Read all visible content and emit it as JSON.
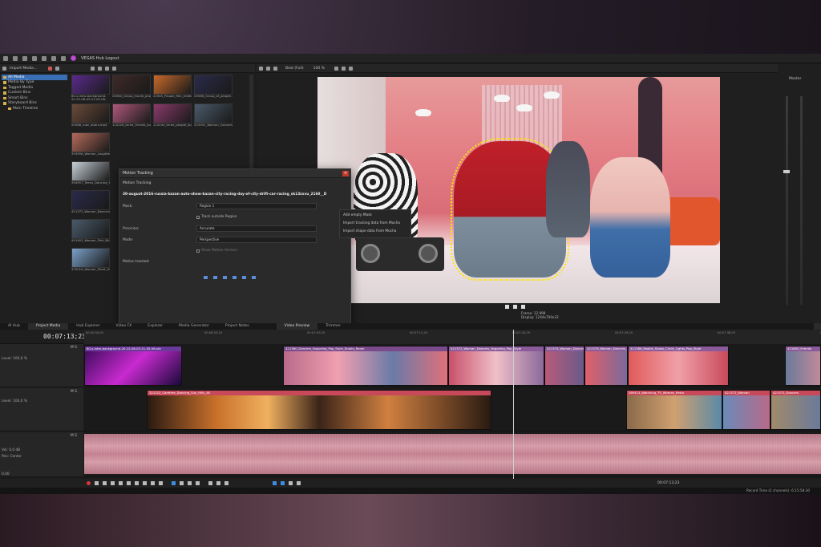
{
  "app": {
    "hub_label": "VEGAS Hub Logout"
  },
  "explorer": {
    "import_label": "Import Media...",
    "tree": [
      {
        "label": "All Media",
        "selected": true
      },
      {
        "label": "Media By Type",
        "selected": false
      },
      {
        "label": "Tagged Media",
        "selected": false
      },
      {
        "label": "Custom Bins",
        "selected": false
      },
      {
        "label": "Smart Bins",
        "selected": false
      },
      {
        "label": "Storyboard Bins",
        "selected": false
      },
      {
        "label": "Main Timeline",
        "selected": false
      }
    ],
    "thumbs": [
      [
        "80-s-intro-background-20-22-08-03-21-05-06-utc...",
        "20564_Group_movie_projector.mp4",
        "20565_People_film_rediector.mp4",
        "20566_Group_of_people..."
      ],
      [
        "20568_man_stairs.mp4",
        "110226_three_friends_looking_at_a_laptop_scr...",
        "110240_three_people_looking_straight_in_the_...",
        "253951_Women_Conversation_Bar_Alcohol_4K..."
      ],
      [
        "353958_Woman_Laughter_Bonding_Conversati...",
        "",
        "",
        ""
      ],
      [
        "394957_Teens_Dancing_Young_Bridge_4K.mp4",
        "",
        "",
        ""
      ],
      [
        "421372_Woman_Dancers_Vogueing_Pop_Style_4...",
        "",
        "",
        ""
      ],
      [
        "441902_Woman_Pink_Bride_Yellow_Jacket_Sm...",
        "",
        "",
        ""
      ],
      [
        "470016_Woman_Short_Hair_Earring_Blue_Dress...",
        "",
        "",
        ""
      ]
    ]
  },
  "preview": {
    "quality": "Best (Full)",
    "zoom": "100 %",
    "project": "Project:  1920x1080x32, 29,970p",
    "preview_res": "Preview:  1920x1080x32, 29,970p",
    "frame": "Frame:    12.999",
    "display": "Display:  1244x700x32"
  },
  "motion_tracking": {
    "title": "Motion Tracking",
    "section": "Motion Tracking",
    "file": "30-august-2016-russia-kazan-auto-show-kazan-city-racing-day-of-city-drift-car-racing_sk13zxvu_2160__D",
    "mask_label": "Mask:",
    "mask_value": "Region 1",
    "track_outside": "Track outside Region",
    "precision_label": "Precision:",
    "precision_value": "Accurate",
    "mode_label": "Mode:",
    "mode_value": "Perspective",
    "show_motion": "Show Motion Vectors",
    "tracked_label": "Motion tracked:",
    "menu": [
      "Add empty Mask",
      "Import tracking data from Mocha",
      "Import shape data from Mocha"
    ]
  },
  "master": {
    "label": "Master"
  },
  "tabs": [
    {
      "label": "AI Hub",
      "active": false
    },
    {
      "label": "Project Media",
      "active": true
    },
    {
      "label": "Hub Explorer",
      "active": false
    },
    {
      "label": "Video FX",
      "active": false
    },
    {
      "label": "Explorer",
      "active": false
    },
    {
      "label": "Media Generator",
      "active": false
    },
    {
      "label": "Project Notes",
      "active": false
    },
    {
      "label": "Video Preview",
      "active": true
    },
    {
      "label": "Trimmer",
      "active": false
    },
    {
      "label": "Master Bus",
      "active": true
    }
  ],
  "timeline": {
    "timecode": "00:07:13;23",
    "ruler": [
      "00:00:00;00",
      "00:06:53;29",
      "00:07:02;29",
      "00:07:11;29",
      "00:07:20;29",
      "00:07:29;29",
      "00:07:38;29",
      "00:07:47;29"
    ],
    "track1_level": "Level: 100,0 %",
    "track2_level": "Level: 100,0 %",
    "audio_vol": "Vol:      0,0 dB",
    "audio_pan": "Pan:      Center",
    "rate": "0,00",
    "clips_v1": [
      "80-s-intro-background-20-22-08-03-21-05-06-utc",
      "421360_Dancers_Vogueing_Pop_Style_Studio_Room",
      "421372_Woman_Dancers_Vogueing_Pop_Style",
      "421374_Woman_Dancers",
      "421379_Woman_Dancers_Vo",
      "421386_Mobile_Shoes_Circle_Lights_Pop_Style",
      "421605_Friends"
    ],
    "clips_v2": [
      "321122_Carefree_Dancing_Sun_Hills_4K",
      "369414_Watching_TV_Woman_Retro",
      "421372_Woman",
      "421372_Dancers"
    ],
    "cursor_time": "00:07:13;23",
    "record_time": "Record Time (2 channels): 6:15:58:30"
  }
}
